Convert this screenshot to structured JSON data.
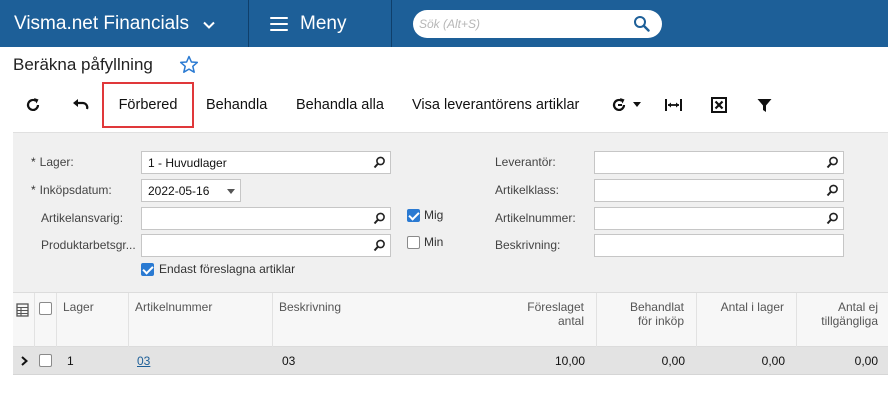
{
  "header": {
    "app_name": "Visma.net Financials",
    "menu_label": "Meny",
    "search_placeholder": "Sök (Alt+S)"
  },
  "page": {
    "title": "Beräkna påfyllning"
  },
  "toolbar": {
    "prepare": "Förbered",
    "process": "Behandla",
    "process_all": "Behandla alla",
    "show_vendor_items": "Visa leverantörens artiklar"
  },
  "form": {
    "warehouse_label": "Lager:",
    "warehouse_value": "1 - Huvudlager",
    "purchase_date_label": "Inköpsdatum:",
    "purchase_date_value": "2022-05-16",
    "item_manager_label": "Artikelansvarig:",
    "product_group_label": "Produktarbetsgr...",
    "me_label": "Mig",
    "min_label": "Min",
    "suggested_only_label": "Endast föreslagna artiklar",
    "vendor_label": "Leverantör:",
    "item_class_label": "Artikelklass:",
    "item_number_label": "Artikelnummer:",
    "description_label": "Beskrivning:",
    "required_mark": "*"
  },
  "grid": {
    "headers": {
      "warehouse": "Lager",
      "item_number": "Artikelnummer",
      "description": "Beskrivning",
      "suggested_1": "Föreslaget",
      "suggested_2": "antal",
      "processed_1": "Behandlat",
      "processed_2": "för inköp",
      "in_stock": "Antal i lager",
      "unavailable_1": "Antal ej",
      "unavailable_2": "tillgängliga"
    },
    "rows": [
      {
        "warehouse": "1",
        "item_number": "03",
        "description": "03",
        "suggested": "10,00",
        "processed": "0,00",
        "in_stock": "0,00",
        "unavailable": "0,00"
      }
    ]
  }
}
